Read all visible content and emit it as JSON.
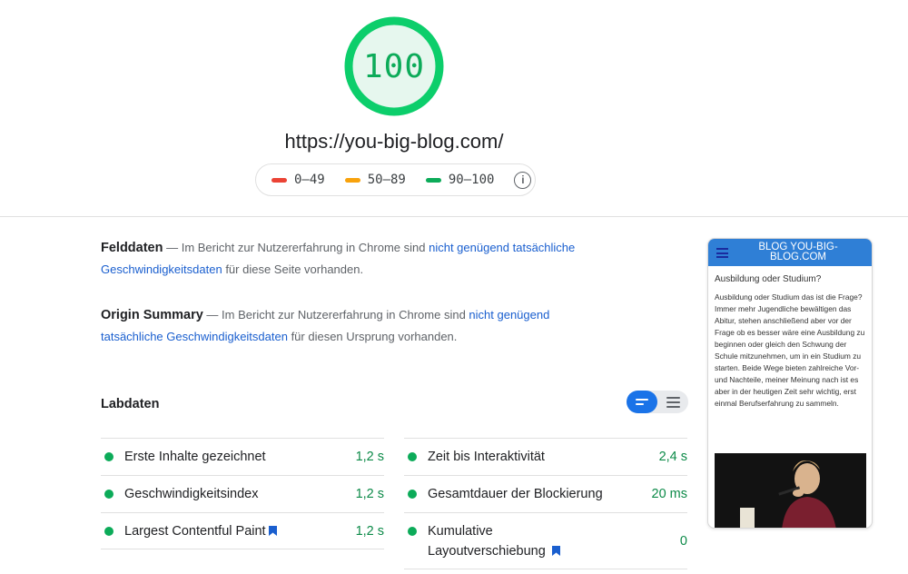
{
  "score": {
    "value": "100",
    "color": "#0cab59"
  },
  "url": "https://you-big-blog.com/",
  "legend": {
    "items": [
      {
        "label": "0–49",
        "color": "#eb4335"
      },
      {
        "label": "50–89",
        "color": "#f8a20c"
      },
      {
        "label": "90–100",
        "color": "#0cab59"
      }
    ],
    "info_icon": "info-icon"
  },
  "field_data": {
    "heading": "Felddaten",
    "text_before": " — Im Bericht zur Nutzererfahrung in Chrome sind ",
    "link_text": "nicht genügend tatsächliche Geschwindigkeitsdaten",
    "text_after": " für diese Seite vorhanden."
  },
  "origin_summary": {
    "heading": "Origin Summary",
    "text_before": " — Im Bericht zur Nutzererfahrung in Chrome sind ",
    "link_text": "nicht genügend tatsächliche Geschwindigkeitsdaten",
    "text_after": " für diesen Ursprung vorhanden."
  },
  "lab_data": {
    "heading": "Labdaten",
    "toggle": {
      "active": "list-view-icon",
      "inactive": "text-view-icon",
      "accent": "#1a73e8"
    },
    "metrics_left": [
      {
        "name": "Erste Inhalte gezeichnet",
        "value": "1,2 s",
        "bookmark": false
      },
      {
        "name": "Geschwindigkeitsindex",
        "value": "1,2 s",
        "bookmark": false
      },
      {
        "name": "Largest Contentful Paint",
        "value": "1,2 s",
        "bookmark": true
      }
    ],
    "metrics_right": [
      {
        "name": "Zeit bis Interaktivität",
        "value": "2,4 s",
        "bookmark": false
      },
      {
        "name": "Gesamtdauer der Blockierung",
        "value": "20 ms",
        "bookmark": false
      },
      {
        "name": "Kumulative Layoutverschiebung",
        "value": "0",
        "bookmark": true
      }
    ],
    "good_color": "#0cab59"
  },
  "preview": {
    "site_title": "BLOG YOU-BIG-BLOG.COM",
    "post_title": "Ausbildung oder Studium?",
    "post_body": "Ausbildung oder Studium das ist die Frage? Immer mehr Jugendliche bewältigen das Abitur, stehen anschließend aber vor der Frage ob es besser wäre eine Ausbildung zu beginnen oder gleich den Schwung der Schule mitzunehmen, um in ein Studium zu starten. Beide Wege bieten zahlreiche Vor- und Nachteile, meiner Meinung nach ist es aber in der heutigen Zeit sehr wichtig, erst einmal Berufserfahrung zu sammeln.",
    "header_color": "#2f7fd6"
  }
}
